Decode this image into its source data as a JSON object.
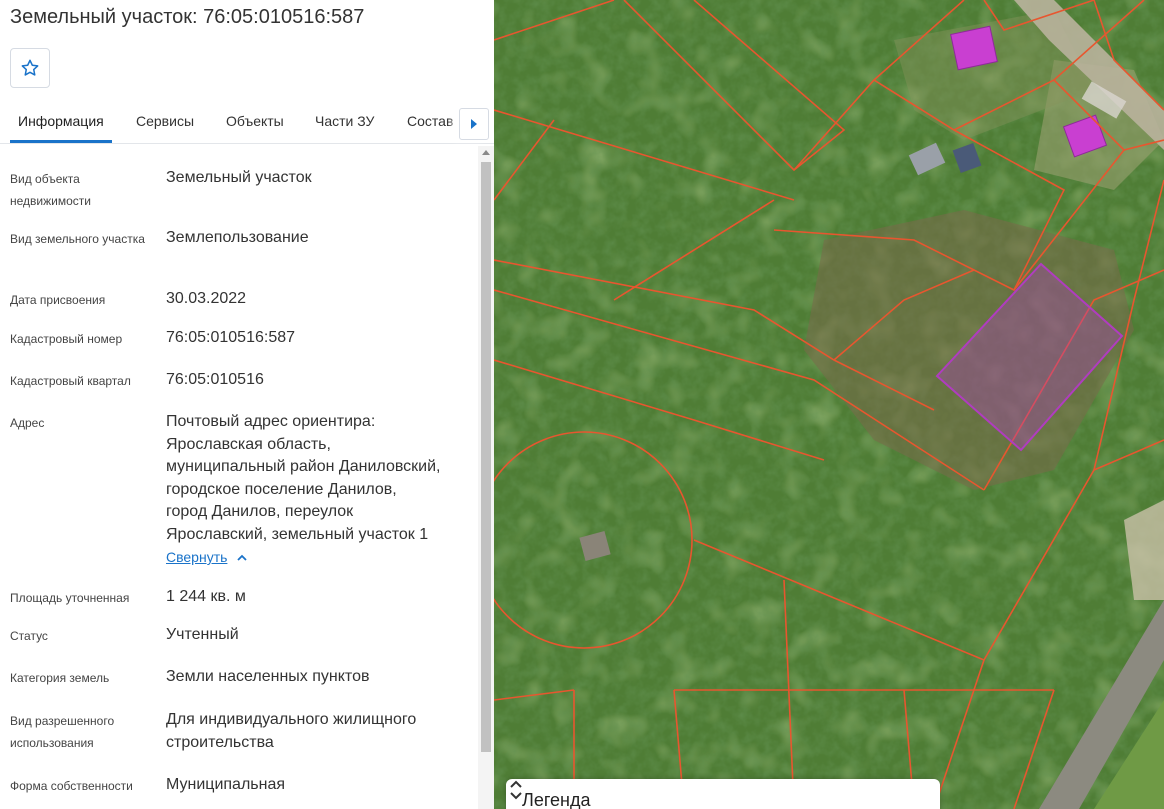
{
  "header": {
    "title": "Земельный участок: 76:05:010516:587",
    "favorite_icon": "star-outline-icon"
  },
  "tabs": [
    {
      "label": "Информация",
      "active": true
    },
    {
      "label": "Сервисы",
      "active": false
    },
    {
      "label": "Объекты",
      "active": false
    },
    {
      "label": "Части ЗУ",
      "active": false
    },
    {
      "label": "Состав",
      "active": false
    }
  ],
  "tabs_next_icon": "chevron-right-icon",
  "info": {
    "object_type": {
      "label": "Вид объекта недвижимости",
      "value": "Земельный участок"
    },
    "parcel_type": {
      "label": "Вид земельного участка",
      "value": "Землепользование"
    },
    "assigned_date": {
      "label": "Дата присвоения",
      "value": "30.03.2022"
    },
    "cadastral_number": {
      "label": "Кадастровый номер",
      "value": "76:05:010516:587"
    },
    "cadastral_block": {
      "label": "Кадастровый квартал",
      "value": "76:05:010516"
    },
    "address": {
      "label": "Адрес",
      "lines": [
        "Почтовый адрес ориентира:",
        "Ярославская область,",
        "муниципальный район Даниловский,",
        "городское поселение Данилов,",
        "город Данилов, переулок",
        "Ярославский, земельный участок 1"
      ],
      "collapse_label": "Свернуть"
    },
    "area": {
      "label": "Площадь уточненная",
      "value": "1 244 кв. м"
    },
    "status": {
      "label": "Статус",
      "value": "Учтенный"
    },
    "land_category": {
      "label": "Категория земель",
      "value": "Земли населенных пунктов"
    },
    "permitted_use": {
      "label": "Вид разрешенного использования",
      "value": "Для индивидуального жилищного строительства"
    },
    "ownership": {
      "label": "Форма собственности",
      "value": "Муниципальная"
    }
  },
  "map": {
    "legend_title": "Легенда",
    "legend_toggle_icon": "expand-collapse-icon",
    "boundary_color": "#e8562f",
    "selected_parcel_color": "#b03cc0",
    "roof_color": "#c93fd1"
  }
}
